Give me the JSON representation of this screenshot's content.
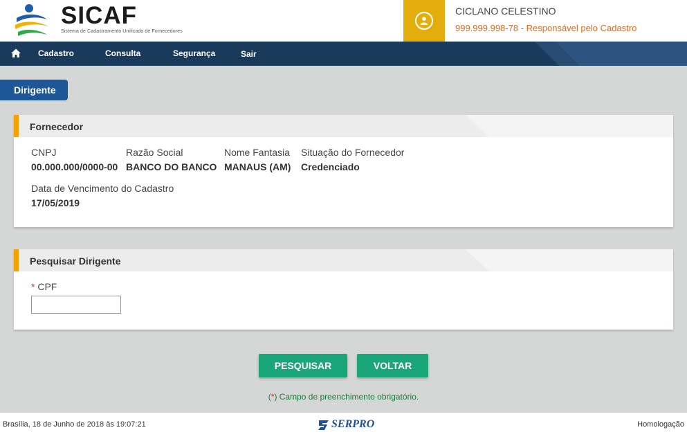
{
  "brand": {
    "title": "SICAF",
    "subtitle": "Sistema de Cadastramento Unificado de Fornecedores"
  },
  "user": {
    "name": "CICLANO CELESTINO",
    "role": "999.999.998-78 - Responsável pelo Cadastro"
  },
  "nav": {
    "items": [
      "Cadastro",
      "Consulta",
      "Segurança",
      "Sair"
    ]
  },
  "page_tab": "Dirigente",
  "fornecedor": {
    "title": "Fornecedor",
    "fields": [
      {
        "label": "CNPJ",
        "value": "00.000.000/0000-00"
      },
      {
        "label": "Razão Social",
        "value": "BANCO DO BANCO"
      },
      {
        "label": "Nome Fantasia",
        "value": "MANAUS (AM)"
      },
      {
        "label": "Situação do Fornecedor",
        "value": "Credenciado"
      },
      {
        "label": "Data de Vencimento do Cadastro",
        "value": "17/05/2019"
      }
    ]
  },
  "pesquisar": {
    "title": "Pesquisar Dirigente",
    "cpf_label": "CPF",
    "required_mark": "*",
    "cpf_value": ""
  },
  "buttons": {
    "search": "PESQUISAR",
    "back": "VOLTAR"
  },
  "note": {
    "open": "(",
    "star": "*",
    "text": ") Campo de preenchimento obrigatório."
  },
  "footer": {
    "datetime": "Brasília, 18 de Junho de 2018 às 19:07:21",
    "vendor": "SERPRO",
    "environment": "Homologação"
  },
  "colors": {
    "nav_bg": "#1a3a5c",
    "accent_yellow": "#e3ae0c",
    "role_orange": "#e06a1f",
    "button_green": "#1aa679",
    "tab_blue": "#1e5797",
    "panel_marker": "#f5a000"
  }
}
